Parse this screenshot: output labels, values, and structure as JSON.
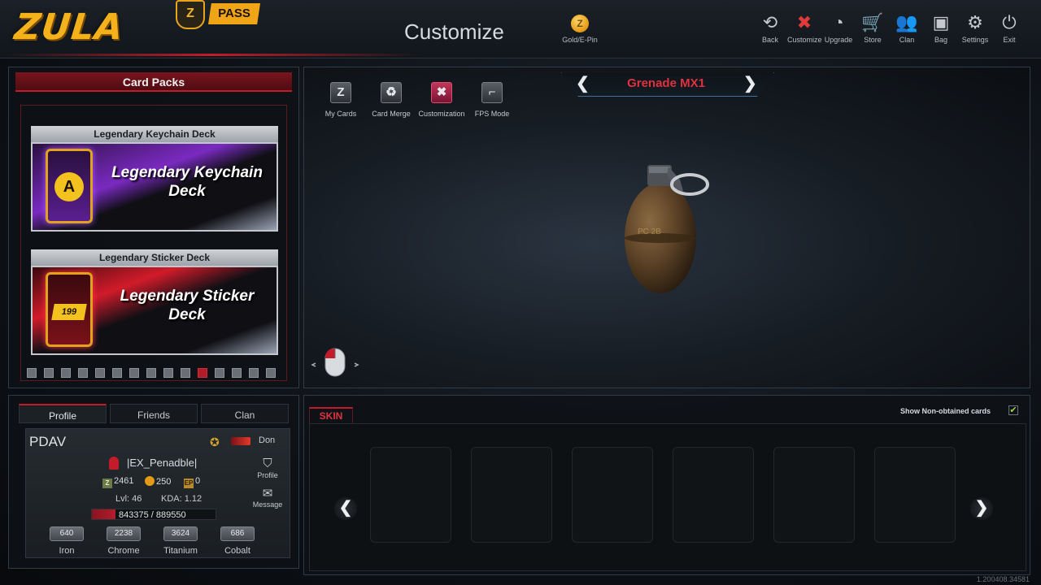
{
  "header": {
    "logo": "ZULA",
    "pass_label": "PASS",
    "pass_icon": "Z",
    "title": "Customize",
    "gold_label": "Gold/E-Pin",
    "gold_icon": "Z",
    "nav": [
      {
        "label": "Back",
        "icon": "⟲"
      },
      {
        "label": "Customize",
        "icon": "✖"
      },
      {
        "label": "Upgrade",
        "icon": "◔"
      },
      {
        "label": "Store",
        "icon": "🛒"
      },
      {
        "label": "Clan",
        "icon": "👥"
      },
      {
        "label": "Bag",
        "icon": "▣"
      },
      {
        "label": "Settings",
        "icon": "⚙"
      },
      {
        "label": "Exit",
        "icon": "⏻"
      }
    ]
  },
  "packs": {
    "header": "Card Packs",
    "decks": [
      {
        "title": "Legendary Keychain Deck",
        "name": "Legendary Keychain Deck",
        "glyph": "A"
      },
      {
        "title": "Legendary Sticker Deck",
        "name": "Legendary Sticker Deck",
        "glyph": "199"
      }
    ],
    "page_count": 15,
    "active_page": 10
  },
  "viewer": {
    "weapon": "Grenade MX1",
    "prev": "❮",
    "next": "❯",
    "grenade_marking": "PC 2B",
    "tools": [
      {
        "label": "My Cards",
        "icon": "Z"
      },
      {
        "label": "Card Merge",
        "icon": "♻"
      },
      {
        "label": "Customization",
        "icon": "✖"
      },
      {
        "label": "FPS Mode",
        "icon": "⌐"
      }
    ]
  },
  "profile": {
    "tabs": [
      "Profile",
      "Friends",
      "Clan"
    ],
    "player": "PDAV",
    "rank": "Don",
    "clan": "|EX_Penadble|",
    "currencies": {
      "zula": "2461",
      "gold": "250",
      "ep": "0"
    },
    "level": "Lvl: 46",
    "kda": "KDA: 1.12",
    "xp_text": "843375 / 889550",
    "xp_fraction": 0.19,
    "profile_btn": "Profile",
    "message_btn": "Message",
    "materials": [
      {
        "value": "640",
        "label": "Iron"
      },
      {
        "value": "2238",
        "label": "Chrome"
      },
      {
        "value": "3624",
        "label": "Titanium"
      },
      {
        "value": "686",
        "label": "Cobalt"
      }
    ]
  },
  "skin": {
    "tab": "SKIN",
    "show_label": "Show Non-obtained cards",
    "checked": "✔",
    "prev": "❮",
    "next": "❯"
  },
  "version": "1.200408.34581",
  "colors": {
    "accent": "#c21b2a",
    "gold": "#f3b21c",
    "weapon_name": "#e0313e"
  }
}
